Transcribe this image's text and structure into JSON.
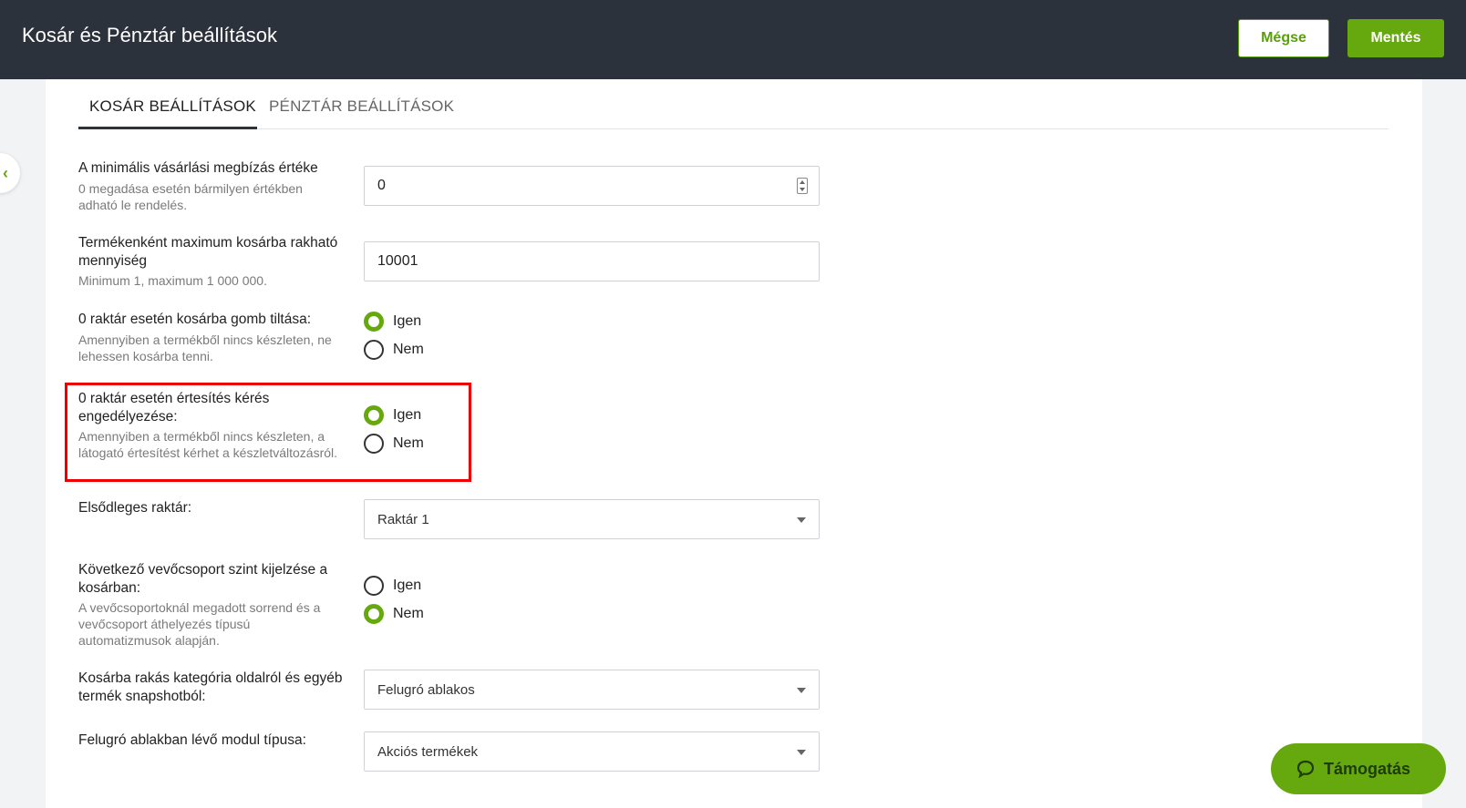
{
  "header": {
    "title": "Kosár és Pénztár beállítások",
    "cancel_label": "Mégse",
    "save_label": "Mentés"
  },
  "tabs": [
    {
      "label": "KOSÁR BEÁLLÍTÁSOK",
      "active": true
    },
    {
      "label": "PÉNZTÁR BEÁLLÍTÁSOK",
      "active": false
    }
  ],
  "settings": {
    "min_order": {
      "label": "A minimális vásárlási megbízás értéke",
      "hint": "0 megadása esetén bármilyen értékben adható le rendelés.",
      "value": "0"
    },
    "max_qty": {
      "label": "Termékenként maximum kosárba rakható mennyiség",
      "hint": "Minimum 1, maximum 1 000 000.",
      "value": "10001"
    },
    "disable_cart_button": {
      "label": "0 raktár esetén kosárba gomb tiltása:",
      "hint": "Amennyiben a termékből nincs készleten, ne lehessen kosárba tenni.",
      "yes": "Igen",
      "no": "Nem",
      "selected": "Igen"
    },
    "notify_request": {
      "label": "0 raktár esetén értesítés kérés engedélyezése:",
      "hint": "Amennyiben a termékből nincs készleten, a látogató értesítést kérhet a készletváltozásról.",
      "yes": "Igen",
      "no": "Nem",
      "selected": "Igen"
    },
    "primary_warehouse": {
      "label": "Elsődleges raktár:",
      "value": "Raktár 1"
    },
    "next_group_level": {
      "label": "Következő vevőcsoport szint kijelzése a kosárban:",
      "hint": "A vevőcsoportoknál megadott sorrend és a vevőcsoport áthelyezés típusú automatizmusok alapján.",
      "yes": "Igen",
      "no": "Nem",
      "selected": "Nem"
    },
    "add_to_cart_mode": {
      "label": "Kosárba rakás kategória oldalról és egyéb termék snapshotból:",
      "value": "Felugró ablakos"
    },
    "popup_module_type": {
      "label": "Felugró ablakban lévő modul típusa:",
      "value": "Akciós termékek"
    }
  },
  "support": {
    "label": "Támogatás"
  },
  "colors": {
    "accent": "#66a90f",
    "topbar": "#2c323b",
    "highlight": "#e00000"
  }
}
